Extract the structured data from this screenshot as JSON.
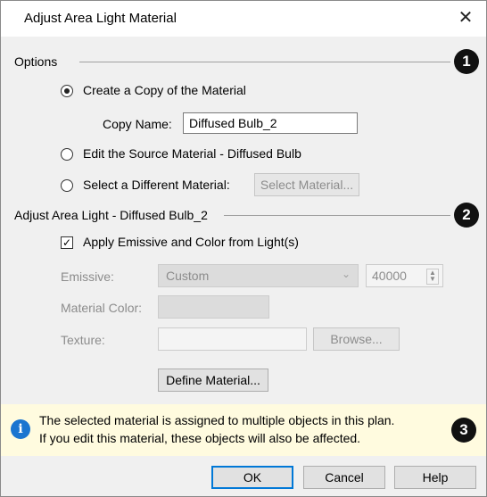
{
  "window": {
    "title": "Adjust Area Light Material",
    "close_glyph": "✕"
  },
  "options": {
    "label": "Options",
    "callout": "1",
    "create_copy": {
      "label": "Create a Copy of the Material",
      "selected": true
    },
    "copy_name": {
      "label": "Copy Name:",
      "value": "Diffused Bulb_2"
    },
    "edit_source": {
      "label": "Edit the Source Material - Diffused Bulb",
      "selected": false
    },
    "select_different": {
      "label": "Select a Different Material:",
      "selected": false,
      "button": "Select Material..."
    }
  },
  "adjust": {
    "label": "Adjust Area Light - Diffused Bulb_2",
    "callout": "2",
    "apply_emissive": {
      "label": "Apply Emissive and Color from Light(s)",
      "checked": true,
      "check_glyph": "✓"
    },
    "emissive": {
      "label": "Emissive:",
      "value": "Custom",
      "number": "40000"
    },
    "material_color": {
      "label": "Material Color:"
    },
    "texture": {
      "label": "Texture:",
      "button": "Browse..."
    },
    "define_button": "Define Material..."
  },
  "info": {
    "icon": "info-icon",
    "line1": "The selected material is assigned to multiple objects in this plan.",
    "line2": "If you edit this material, these objects will also be affected.",
    "callout": "3"
  },
  "footer": {
    "ok": "OK",
    "cancel": "Cancel",
    "help": "Help"
  },
  "colors": {
    "accent": "#0078d7",
    "info_bg": "#fffbdf",
    "info_icon": "#1b75d0"
  }
}
